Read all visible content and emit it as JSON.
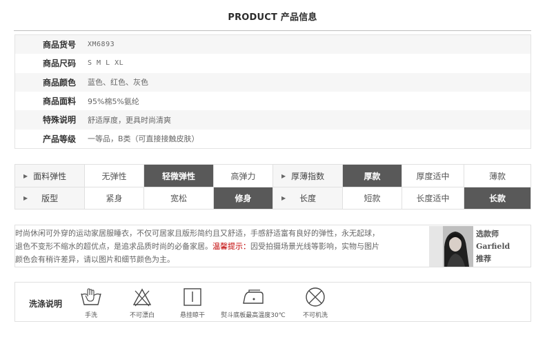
{
  "header": {
    "title": "PRODUCT 产品信息"
  },
  "spec": [
    {
      "key": "商品货号",
      "value": "XM6893"
    },
    {
      "key": "商品尺码",
      "value": "S M L XL"
    },
    {
      "key": "商品颜色",
      "value": "蓝色、红色、灰色"
    },
    {
      "key": "商品面料",
      "value": "95%棉5%氨纶"
    },
    {
      "key": "特殊说明",
      "value": "舒适厚度，更具时尚清爽"
    },
    {
      "key": "产品等级",
      "value": "一等品，B类（可直接接触皮肤）"
    }
  ],
  "attributes": {
    "elasticity": {
      "label": "面料弹性",
      "options": [
        "无弹性",
        "轻微弹性",
        "高弹力"
      ],
      "selected": 1
    },
    "thickness": {
      "label": "厚薄指数",
      "options": [
        "厚款",
        "厚度适中",
        "薄款"
      ],
      "selected": 0
    },
    "fit": {
      "label": "版型",
      "options": [
        "紧身",
        "宽松",
        "修身"
      ],
      "selected": 2
    },
    "length": {
      "label": "长度",
      "options": [
        "短款",
        "长度适中",
        "长款"
      ],
      "selected": 2
    }
  },
  "description": {
    "line1": "时尚休闲可外穿的运动家居服睡衣，不仅可居家且版形简约且又舒适，手感舒适富有良好的弹性，永无起球，",
    "line2_pre": "退色不变形不缩水的超优点，是追求品质时尚的必备家居。",
    "warn": "温馨提示：",
    "line2_post": "因受拍摄场景光线等影响，实物与图片",
    "line3": "颜色会有稍许差异，请以图片和细节颜色为主。"
  },
  "stylist": {
    "l1": "选款师",
    "l2": "Garfield",
    "l3": "推荐"
  },
  "wash": {
    "title": "洗涤说明",
    "items": [
      {
        "icon": "hand-wash-icon",
        "label": "手洗"
      },
      {
        "icon": "no-bleach-icon",
        "label": "不可漂白"
      },
      {
        "icon": "hang-dry-icon",
        "label": "悬挂晾干"
      },
      {
        "icon": "iron-icon",
        "label": "熨斗底板最高温度30℃"
      },
      {
        "icon": "no-machine-wash-icon",
        "label": "不可机洗"
      }
    ]
  }
}
